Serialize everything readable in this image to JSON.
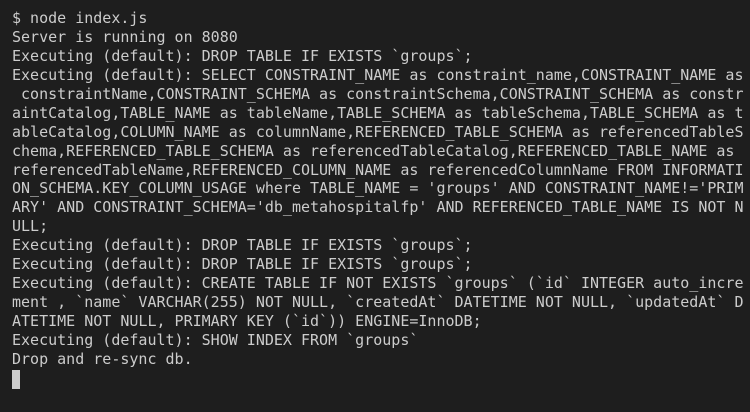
{
  "terminal": {
    "colors": {
      "background": "#1e1e1e",
      "foreground": "#cccccc"
    },
    "lines": [
      "$ node index.js",
      "Server is running on 8080",
      "Executing (default): DROP TABLE IF EXISTS `groups`;",
      "Executing (default): SELECT CONSTRAINT_NAME as constraint_name,CONSTRAINT_NAME as",
      " constraintName,CONSTRAINT_SCHEMA as constraintSchema,CONSTRAINT_SCHEMA as constr",
      "aintCatalog,TABLE_NAME as tableName,TABLE_SCHEMA as tableSchema,TABLE_SCHEMA as t",
      "ableCatalog,COLUMN_NAME as columnName,REFERENCED_TABLE_SCHEMA as referencedTableS",
      "chema,REFERENCED_TABLE_SCHEMA as referencedTableCatalog,REFERENCED_TABLE_NAME as",
      "referencedTableName,REFERENCED_COLUMN_NAME as referencedColumnName FROM INFORMATI",
      "ON_SCHEMA.KEY_COLUMN_USAGE where TABLE_NAME = 'groups' AND CONSTRAINT_NAME!='PRIM",
      "ARY' AND CONSTRAINT_SCHEMA='db_metahospitalfp' AND REFERENCED_TABLE_NAME IS NOT N",
      "ULL;",
      "Executing (default): DROP TABLE IF EXISTS `groups`;",
      "Executing (default): DROP TABLE IF EXISTS `groups`;",
      "Executing (default): CREATE TABLE IF NOT EXISTS `groups` (`id` INTEGER auto_incre",
      "ment , `name` VARCHAR(255) NOT NULL, `createdAt` DATETIME NOT NULL, `updatedAt` D",
      "ATETIME NOT NULL, PRIMARY KEY (`id`)) ENGINE=InnoDB;",
      "Executing (default): SHOW INDEX FROM `groups`",
      "Drop and re-sync db."
    ]
  }
}
